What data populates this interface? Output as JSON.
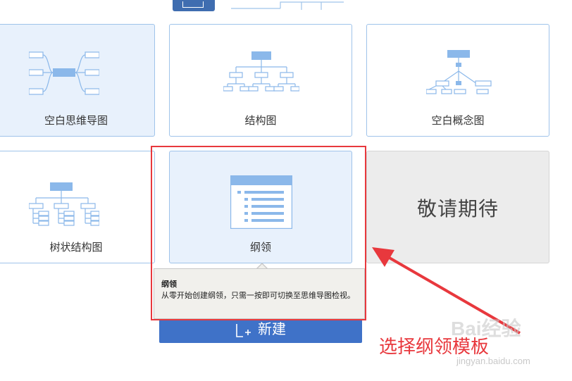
{
  "templates": [
    {
      "label": "空白思维导图",
      "icon": "blank-mindmap-icon"
    },
    {
      "label": "结构图",
      "icon": "org-structure-icon"
    },
    {
      "label": "空白概念图",
      "icon": "concept-map-icon"
    },
    {
      "label": "树状结构图",
      "icon": "tree-structure-icon"
    },
    {
      "label": "纲领",
      "icon": "outline-icon"
    }
  ],
  "coming_soon": "敬请期待",
  "tooltip": {
    "title": "纲领",
    "description": "从零开始创建纲领，只需一按即可切换至思维导图检视。"
  },
  "new_button": {
    "label": "新建"
  },
  "annotation": {
    "text": "选择纲领模板"
  },
  "watermark": {
    "text": "Bai经验",
    "url": "jingyan.baidu.com"
  },
  "colors": {
    "accent": "#3f72c8",
    "card_border": "#9fc3ea",
    "card_tint": "#e8f1fc",
    "annotation_red": "#e8383d"
  }
}
